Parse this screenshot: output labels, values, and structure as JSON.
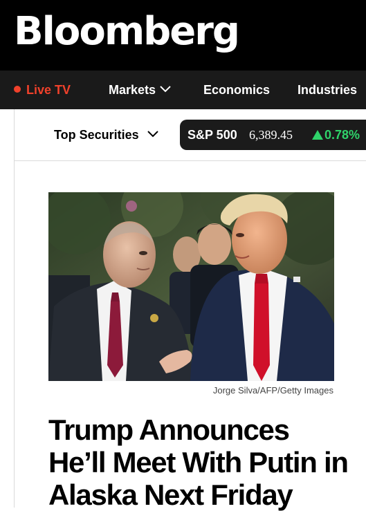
{
  "brand": {
    "logo_text": "Bloomberg"
  },
  "nav": {
    "live_label": "Live TV",
    "items": [
      {
        "label": "Markets",
        "has_dropdown": true
      },
      {
        "label": "Economics"
      },
      {
        "label": "Industries"
      }
    ]
  },
  "subnav": {
    "top_securities_label": "Top Securities",
    "ticker": {
      "name": "S&P 500",
      "price": "6,389.45",
      "change": "0.78%",
      "direction": "up",
      "change_color": "#2fd36a"
    }
  },
  "article": {
    "image_credit": "Jorge Silva/AFP/Getty Images",
    "headline": "Trump Announces He’ll Meet With Putin in Alaska Next Friday"
  },
  "colors": {
    "masthead": "#000000",
    "navbar": "#1a1a1a",
    "live": "#f0412b",
    "up": "#2fd36a",
    "tie_trump": "#d0102a",
    "tie_putin": "#8c1a3a"
  }
}
